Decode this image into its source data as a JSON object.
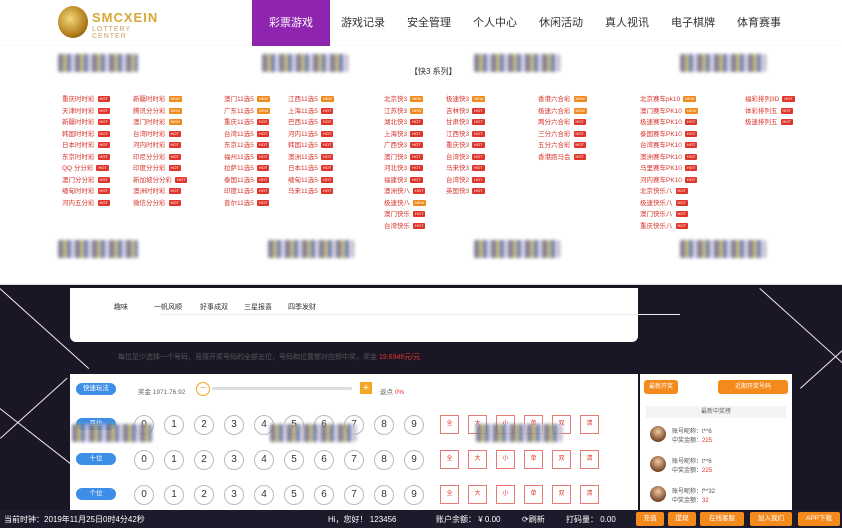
{
  "brand": {
    "name": "SMCXEIN",
    "sub": "LOTTERY CENTER"
  },
  "nav": [
    "彩票游戏",
    "游戏记录",
    "安全管理",
    "个人中心",
    "休闲活动",
    "真人视讯",
    "电子棋牌",
    "体育赛事"
  ],
  "series_title": "【快3 系列】",
  "lottery_columns": [
    [
      {
        "label": "重庆时时彩",
        "tag": "HOT"
      },
      {
        "label": "天津时时彩",
        "tag": "HOT"
      },
      {
        "label": "新疆时时彩",
        "tag": "HOT"
      },
      {
        "label": "韩国时时彩",
        "tag": "HOT"
      },
      {
        "label": "日本时时彩",
        "tag": "HOT"
      },
      {
        "label": "东京时时彩",
        "tag": "HOT"
      },
      {
        "label": "QQ 分分彩",
        "tag": "HOT"
      },
      {
        "label": "澳门分分彩",
        "tag": "HOT"
      },
      {
        "label": "缅甸时时彩",
        "tag": "HOT"
      },
      {
        "label": "河内五分彩",
        "tag": "HOT"
      }
    ],
    [
      {
        "label": "新疆时时彩",
        "tag": "NEW"
      },
      {
        "label": "腾讯分分彩",
        "tag": "NEW"
      },
      {
        "label": "澳门时时彩",
        "tag": "NEW"
      },
      {
        "label": "台湾时时彩",
        "tag": "HOT"
      },
      {
        "label": "河内时时彩",
        "tag": "HOT"
      },
      {
        "label": "印尼分分彩",
        "tag": "HOT"
      },
      {
        "label": "印度分分彩",
        "tag": "HOT"
      },
      {
        "label": "新加坡分分彩",
        "tag": "HOT"
      },
      {
        "label": "澳洲时时彩",
        "tag": "HOT"
      },
      {
        "label": "微信分分彩",
        "tag": "HOT"
      }
    ],
    [
      {
        "label": "澳门11选5",
        "tag": "NEW"
      },
      {
        "label": "广东11选5",
        "tag": "NEW"
      },
      {
        "label": "重庆11选5",
        "tag": "HOT"
      },
      {
        "label": "台湾11选5",
        "tag": "HOT"
      },
      {
        "label": "东京11选5",
        "tag": "HOT"
      },
      {
        "label": "福州11选5",
        "tag": "HOT"
      },
      {
        "label": "拉萨11选5",
        "tag": "HOT"
      },
      {
        "label": "泰国11选5",
        "tag": "HOT"
      },
      {
        "label": "印度11选5",
        "tag": "HOT"
      },
      {
        "label": "普尔11选5",
        "tag": "HOT"
      }
    ],
    [
      {
        "label": "江西11选5",
        "tag": "NEW"
      },
      {
        "label": "上海11选5",
        "tag": "HOT"
      },
      {
        "label": "巴西11选5",
        "tag": "HOT"
      },
      {
        "label": "河内11选5",
        "tag": "HOT"
      },
      {
        "label": "韩国11选5",
        "tag": "HOT"
      },
      {
        "label": "澳洲11选5",
        "tag": "HOT"
      },
      {
        "label": "日本11选5",
        "tag": "HOT"
      },
      {
        "label": "缅甸11选5",
        "tag": "HOT"
      },
      {
        "label": "马来11选5",
        "tag": "HOT"
      }
    ],
    [
      {
        "label": "北京快3",
        "tag": "NEW"
      },
      {
        "label": "江苏快3",
        "tag": "NEW"
      },
      {
        "label": "湖北快3",
        "tag": "HOT"
      },
      {
        "label": "上海快3",
        "tag": "HOT"
      },
      {
        "label": "广西快3",
        "tag": "HOT"
      },
      {
        "label": "澳门快3",
        "tag": "HOT"
      },
      {
        "label": "河北快3",
        "tag": "HOT"
      },
      {
        "label": "福建快3",
        "tag": "HOT"
      },
      {
        "label": "澳洲快八",
        "tag": "HOT"
      },
      {
        "label": "极速快八",
        "tag": "NEW"
      },
      {
        "label": "澳门快乐",
        "tag": "HOT"
      },
      {
        "label": "台湾快乐",
        "tag": "HOT"
      }
    ],
    [
      {
        "label": "极速快3",
        "tag": "NEW"
      },
      {
        "label": "吉林快3",
        "tag": "HOT"
      },
      {
        "label": "甘肃快3",
        "tag": "HOT"
      },
      {
        "label": "江西快3",
        "tag": "HOT"
      },
      {
        "label": "重庆快3",
        "tag": "HOT"
      },
      {
        "label": "台湾快3",
        "tag": "HOT"
      },
      {
        "label": "马来快3",
        "tag": "HOT"
      },
      {
        "label": "台湾快2",
        "tag": "HOT"
      },
      {
        "label": "英国快3",
        "tag": "HOT"
      }
    ],
    [
      {
        "label": "香港六合彩",
        "tag": "NEW"
      },
      {
        "label": "极速六合彩",
        "tag": "NEW"
      },
      {
        "label": "两分六合彩",
        "tag": "HOT"
      },
      {
        "label": "三分六合彩",
        "tag": "HOT"
      },
      {
        "label": "五分六合彩",
        "tag": "HOT"
      },
      {
        "label": "香港跑马会",
        "tag": "HOT"
      }
    ],
    [
      {
        "label": "北京赛车pk10",
        "tag": "NEW"
      },
      {
        "label": "澳门赛车PK10",
        "tag": "NEW"
      },
      {
        "label": "极速赛车PK10",
        "tag": "HOT"
      },
      {
        "label": "泰国赛车PK10",
        "tag": "HOT"
      },
      {
        "label": "台湾赛车PK10",
        "tag": "HOT"
      },
      {
        "label": "澳洲赛车PK10",
        "tag": "HOT"
      },
      {
        "label": "马里赛车PK10",
        "tag": "HOT"
      },
      {
        "label": "河内赛车PK10",
        "tag": "HOT"
      },
      {
        "label": "北京快乐八",
        "tag": "HOT"
      },
      {
        "label": "极速快乐八",
        "tag": "HOT"
      },
      {
        "label": "澳门快乐八",
        "tag": "HOT"
      },
      {
        "label": "重庆快乐八",
        "tag": "HOT"
      }
    ],
    [
      {
        "label": "福彩排列3D",
        "tag": "HOT"
      },
      {
        "label": "体彩排列五",
        "tag": "HOT"
      },
      {
        "label": "极速排列五",
        "tag": "HOT"
      }
    ]
  ],
  "tabs": [
    "趣味",
    "一帆风顺",
    "好事成双",
    "三星报喜",
    "四季发财"
  ],
  "rule": {
    "text": "每位至少选择一个号码，竞猜开奖号码的全部五位，号码和位置都对应即中奖，奖金",
    "prize": "19.6946元/元"
  },
  "bet_controls": {
    "mode_label": "快速玩法",
    "odds_label": "奖金 1971.76.92",
    "rebate_label": "返点",
    "rebate_value": "0%",
    "minus": "−",
    "plus": "+"
  },
  "rows": [
    {
      "label": "百位",
      "numbers": [
        "0",
        "1",
        "2",
        "3",
        "4",
        "5",
        "6",
        "7",
        "8",
        "9"
      ]
    },
    {
      "label": "十位",
      "numbers": [
        "0",
        "1",
        "2",
        "3",
        "4",
        "5",
        "6",
        "7",
        "8",
        "9"
      ]
    },
    {
      "label": "个位",
      "numbers": [
        "0",
        "1",
        "2",
        "3",
        "4",
        "5",
        "6",
        "7",
        "8",
        "9"
      ]
    }
  ],
  "quick_buttons": [
    "全",
    "大",
    "小",
    "单",
    "双",
    "清"
  ],
  "side": {
    "btn1": "最新开奖",
    "btn2": "近期开奖号码",
    "winners_head": "最新中奖榜",
    "winners": [
      {
        "account": "账号昵称：t**6",
        "amount_label": "中奖金额：",
        "amount": "225"
      },
      {
        "account": "账号昵称：t**6",
        "amount_label": "中奖金额：",
        "amount": "225"
      },
      {
        "account": "账号昵称：f**32",
        "amount_label": "中奖金额：",
        "amount": "32"
      }
    ]
  },
  "footer": {
    "time_label": "当前时钟：",
    "time": "2019年11月25日0时4分42秒",
    "greeting": "Hi，您好！",
    "username": "123456",
    "balance_label": "账户余额：",
    "balance": "¥ 0.00",
    "refresh": "刷新",
    "code_label": "打码量：",
    "code_amount": "0.00",
    "buttons": [
      "充值",
      "提现",
      "在线客服",
      "加入我们",
      "APP下载"
    ]
  }
}
